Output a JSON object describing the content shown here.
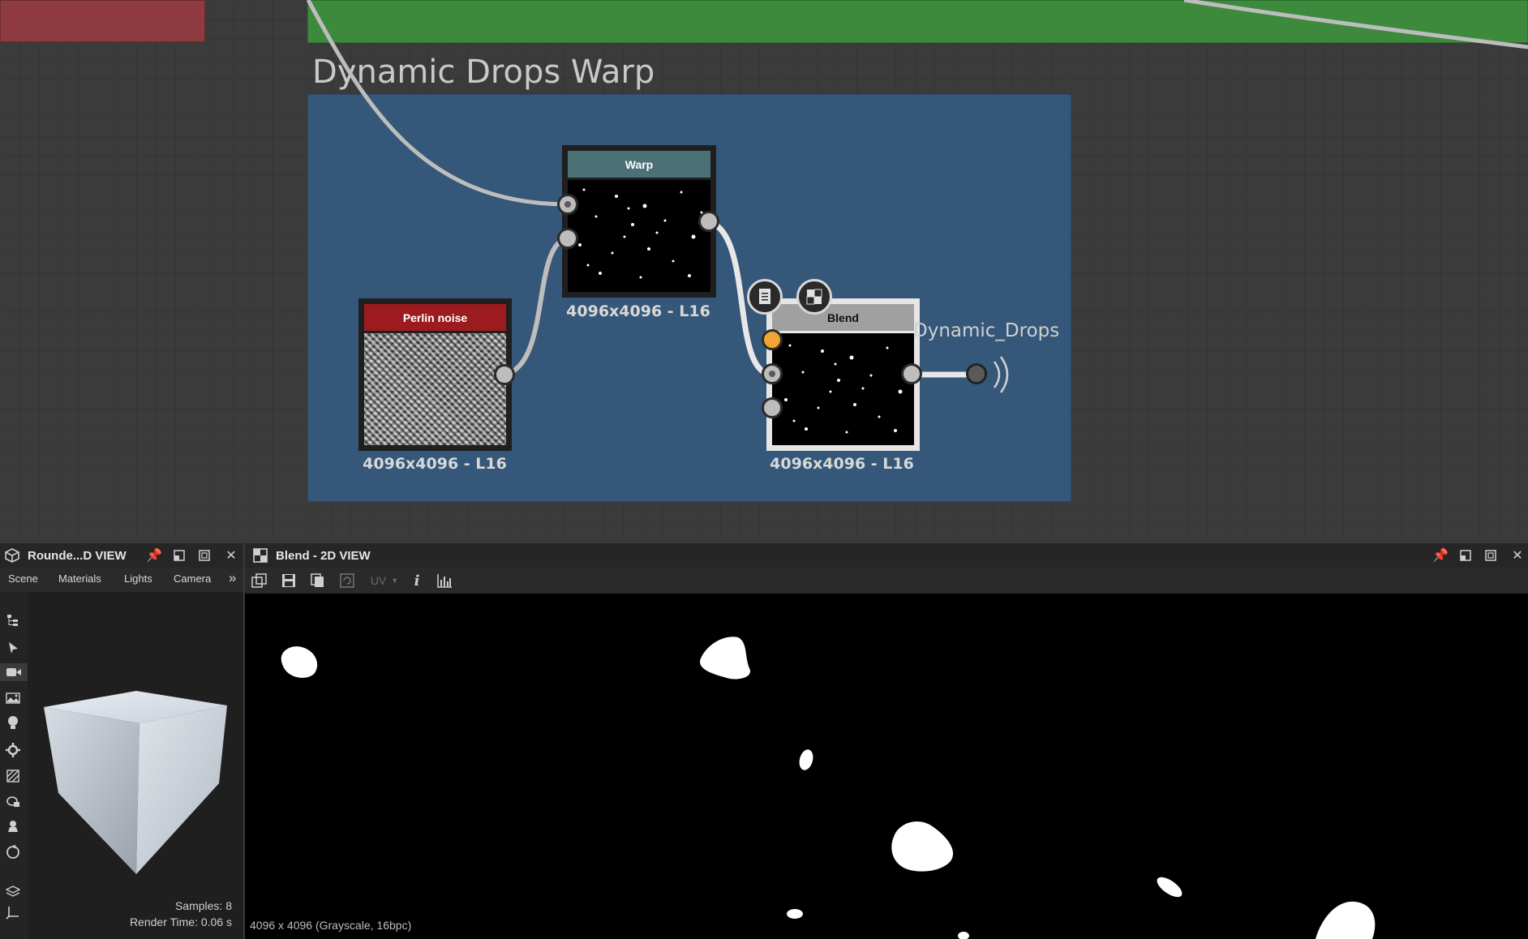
{
  "graph": {
    "frame_title": "Dynamic Drops Warp",
    "nodes": {
      "warp": {
        "title": "Warp",
        "resolution": "4096x4096 - L16",
        "header_color": "#4b7076"
      },
      "perlin": {
        "title": "Perlin noise",
        "resolution": "4096x4096 - L16",
        "header_color": "#9c1b1f"
      },
      "blend": {
        "title": "Blend",
        "resolution": "4096x4096 - L16",
        "header_color": "#a0a0a0"
      }
    },
    "output_label": "Dynamic_Drops",
    "colors": {
      "frame_blue": "#355779",
      "frame_green": "#3d8a3d",
      "frame_red": "#8e3a3e",
      "port_orange": "#f0a534"
    }
  },
  "view3d": {
    "title": "Rounde...D VIEW",
    "tabs": [
      "Scene",
      "Materials",
      "Lights",
      "Camera"
    ],
    "more": "»",
    "samples": "Samples: 8",
    "render_time": "Render Time: 0.06 s",
    "tools": [
      "hierarchy-icon",
      "select-arrow-icon",
      "camera-icon",
      "environment-icon",
      "light-icon",
      "settings-icon",
      "texture-icon",
      "shape-icon",
      "pedestal-icon",
      "rotate-icon",
      "layers-icon",
      "axis-icon"
    ]
  },
  "view2d": {
    "title": "Blend - 2D VIEW",
    "uv_label": "UV",
    "info_label": "i",
    "status": "4096 x 4096 (Grayscale, 16bpc)"
  }
}
